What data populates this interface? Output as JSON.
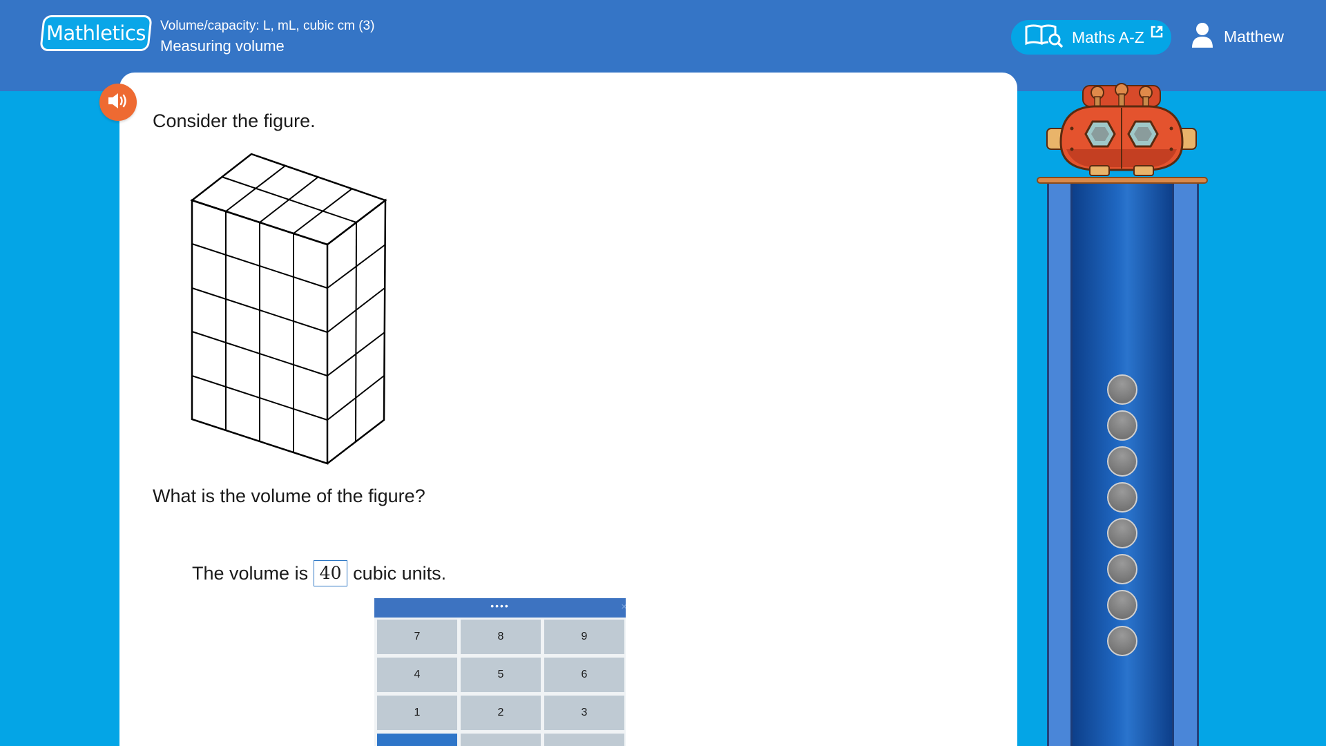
{
  "header": {
    "logo_text": "Mathletics",
    "topic": "Volume/capacity: L, mL, cubic cm (3)",
    "subtopic": "Measuring volume",
    "maths_az_label": "Maths A-Z",
    "user_name": "Matthew"
  },
  "question": {
    "prompt": "Consider the figure.",
    "question_text": "What is the volume of the figure?",
    "answer_prefix": "The volume is",
    "answer_value": "40",
    "answer_suffix": "cubic units."
  },
  "keypad": {
    "handle": "••••",
    "close": "×",
    "keys": [
      "7",
      "8",
      "9",
      "4",
      "5",
      "6",
      "1",
      "2",
      "3",
      "",
      "",
      ""
    ]
  },
  "colors": {
    "header_bg": "#3575c6",
    "page_bg": "#04a5e6",
    "audio_button": "#ee6a32",
    "keypad_bar": "#3d73c1",
    "key_bg": "#bfcad3"
  },
  "progress": {
    "balls_filled": 8
  },
  "icons": {
    "audio": "speaker-icon",
    "maths_az": "book-search-icon",
    "external": "external-link-icon",
    "user": "user-icon"
  }
}
